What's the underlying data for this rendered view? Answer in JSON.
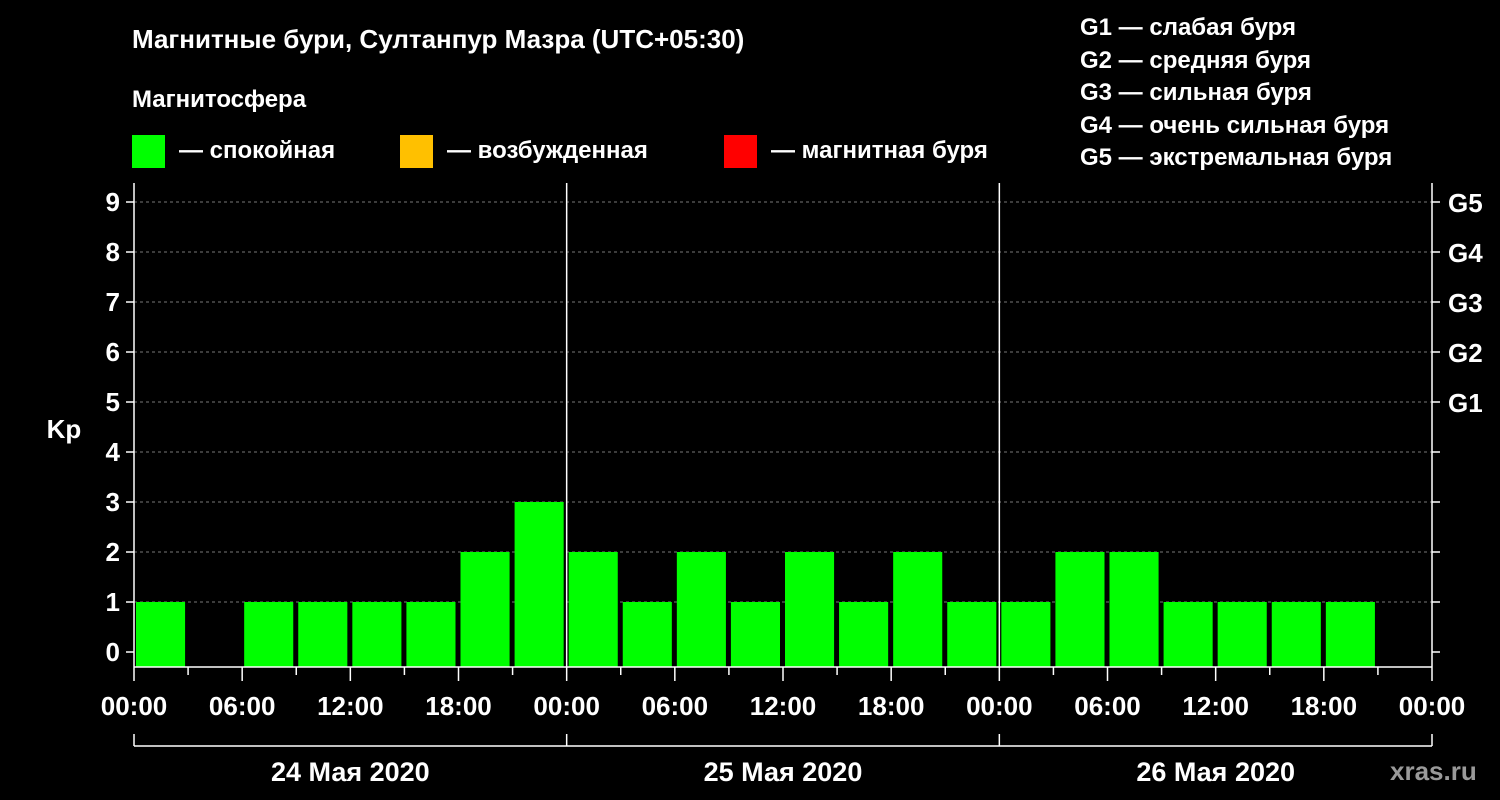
{
  "title": "Магнитные бури, Султанпур Мазра (UTC+05:30)",
  "legend": {
    "title": "Магнитосфера",
    "items": [
      {
        "color": "#00ff00",
        "label": "— спокойная"
      },
      {
        "color": "#ffc000",
        "label": "— возбужденная"
      },
      {
        "color": "#ff0000",
        "label": "— магнитная буря"
      }
    ]
  },
  "storm_levels": [
    "G1 — слабая буря",
    "G2 — средняя буря",
    "G3 — сильная буря",
    "G4 — очень сильная буря",
    "G5 — экстремальная буря"
  ],
  "watermark": "xras.ru",
  "chart_data": {
    "type": "bar",
    "ylabel": "Kp",
    "ylim": [
      0,
      9
    ],
    "yticks": [
      "0",
      "1",
      "2",
      "3",
      "4",
      "5",
      "6",
      "7",
      "8",
      "9"
    ],
    "right_ticks": [
      {
        "value": 5,
        "label": "G1"
      },
      {
        "value": 6,
        "label": "G2"
      },
      {
        "value": 7,
        "label": "G3"
      },
      {
        "value": 8,
        "label": "G4"
      },
      {
        "value": 9,
        "label": "G5"
      }
    ],
    "grid": "dashed horizontal",
    "bar_color": "#00ff00",
    "xticks": [
      "00:00",
      "06:00",
      "12:00",
      "18:00",
      "00:00",
      "06:00",
      "12:00",
      "18:00",
      "00:00",
      "06:00",
      "12:00",
      "18:00",
      "00:00"
    ],
    "days": [
      "24 Мая 2020",
      "25 Мая 2020",
      "26 Мая 2020"
    ],
    "x": [
      "24 Мая 2020 00:00",
      "24 Мая 2020 03:00",
      "24 Мая 2020 06:00",
      "24 Мая 2020 09:00",
      "24 Мая 2020 12:00",
      "24 Мая 2020 15:00",
      "24 Мая 2020 18:00",
      "24 Мая 2020 21:00",
      "25 Мая 2020 00:00",
      "25 Мая 2020 03:00",
      "25 Мая 2020 06:00",
      "25 Мая 2020 09:00",
      "25 Мая 2020 12:00",
      "25 Мая 2020 15:00",
      "25 Мая 2020 18:00",
      "25 Мая 2020 21:00",
      "26 Мая 2020 00:00",
      "26 Мая 2020 03:00",
      "26 Мая 2020 06:00",
      "26 Мая 2020 09:00",
      "26 Мая 2020 12:00",
      "26 Мая 2020 15:00",
      "26 Мая 2020 18:00"
    ],
    "values": [
      1,
      0,
      1,
      1,
      1,
      1,
      2,
      3,
      2,
      1,
      2,
      1,
      2,
      1,
      2,
      1,
      1,
      2,
      2,
      1,
      1,
      1,
      1
    ]
  }
}
